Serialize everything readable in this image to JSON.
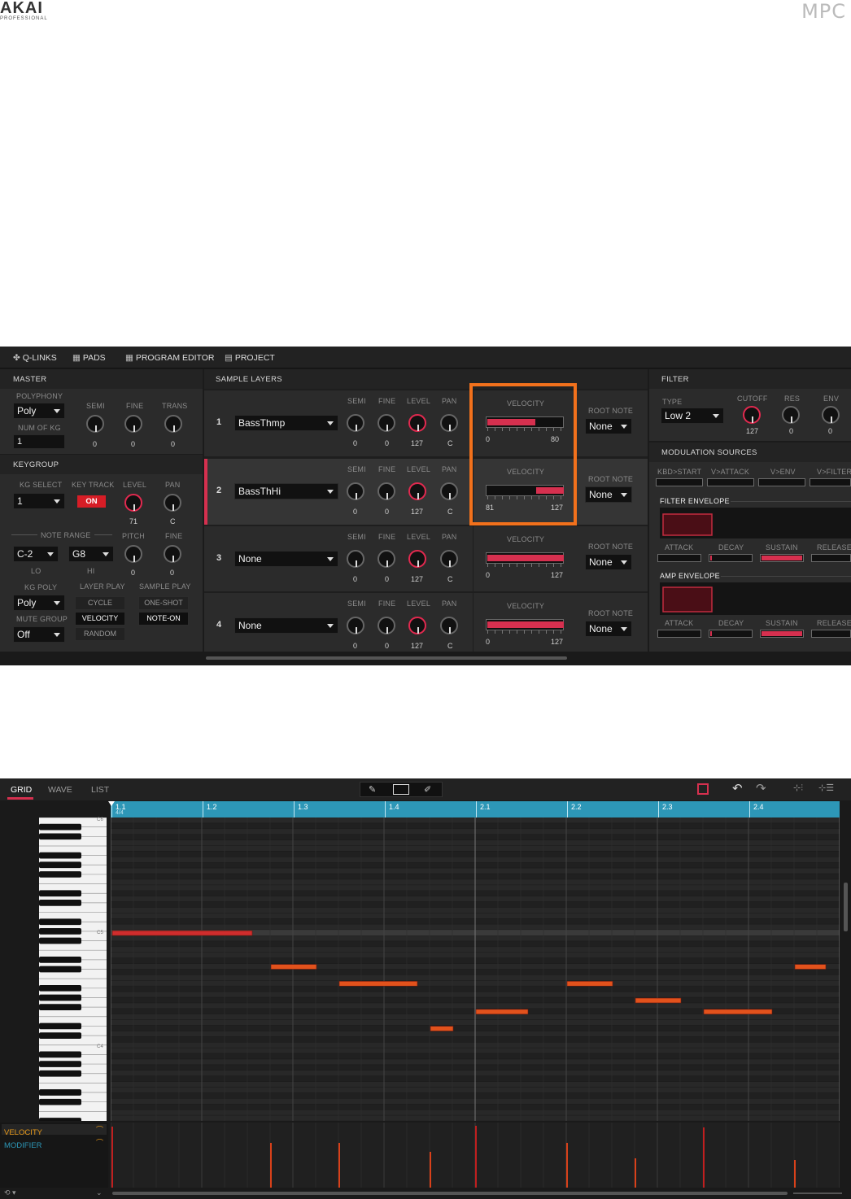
{
  "brand": {
    "left": "AKAI",
    "left_sub": "PROFESSIONAL",
    "right": "MPC"
  },
  "editor": {
    "tabs": [
      "Q-LINKS",
      "PADS",
      "PROGRAM EDITOR",
      "PROJECT"
    ],
    "master": {
      "title": "MASTER",
      "polyphony_label": "POLYPHONY",
      "polyphony_value": "Poly",
      "num_kg_label": "NUM OF KG",
      "num_kg_value": "1",
      "semi_label": "SEMI",
      "fine_label": "FINE",
      "trans_label": "TRANS",
      "semi": "0",
      "fine": "0",
      "trans": "0"
    },
    "keygroup": {
      "title": "KEYGROUP",
      "kg_select_label": "KG SELECT",
      "kg_select_value": "1",
      "key_track_label": "KEY TRACK",
      "key_track_value": "ON",
      "level_label": "LEVEL",
      "level_value": "71",
      "pan_label": "PAN",
      "pan_value": "C",
      "note_range_label": "NOTE RANGE",
      "lo_value": "C-2",
      "hi_value": "G8",
      "lo_label": "LO",
      "hi_label": "HI",
      "pitch_label": "PITCH",
      "pitch_value": "0",
      "fine_label": "FINE",
      "fine_value": "0",
      "kg_poly_label": "KG POLY",
      "kg_poly_value": "Poly",
      "mute_group_label": "MUTE GROUP",
      "mute_group_value": "Off",
      "layer_play_label": "LAYER PLAY",
      "layer_play_options": [
        "CYCLE",
        "VELOCITY",
        "RANDOM"
      ],
      "sample_play_label": "SAMPLE PLAY",
      "sample_play_options": [
        "ONE-SHOT",
        "NOTE-ON"
      ]
    },
    "sample_layers": {
      "title": "SAMPLE LAYERS",
      "semi_label": "SEMI",
      "fine_label": "FINE",
      "level_label": "LEVEL",
      "pan_label": "PAN",
      "velocity_label": "VELOCITY",
      "root_note_label": "ROOT NOTE",
      "layers": [
        {
          "num": "1",
          "sample": "BassThmp",
          "semi": "0",
          "fine": "0",
          "level": "127",
          "pan": "C",
          "vel_lo": "0",
          "vel_hi": "80",
          "root": "None"
        },
        {
          "num": "2",
          "sample": "BassThHi",
          "semi": "0",
          "fine": "0",
          "level": "127",
          "pan": "C",
          "vel_lo": "81",
          "vel_hi": "127",
          "root": "None"
        },
        {
          "num": "3",
          "sample": "None",
          "semi": "0",
          "fine": "0",
          "level": "127",
          "pan": "C",
          "vel_lo": "0",
          "vel_hi": "127",
          "root": "None"
        },
        {
          "num": "4",
          "sample": "None",
          "semi": "0",
          "fine": "0",
          "level": "127",
          "pan": "C",
          "vel_lo": "0",
          "vel_hi": "127",
          "root": "None"
        }
      ]
    },
    "filter": {
      "title": "FILTER",
      "type_label": "TYPE",
      "type_value": "Low 2",
      "cutoff_label": "CUTOFF",
      "cutoff_value": "127",
      "res_label": "RES",
      "res_value": "0",
      "env_label": "ENV",
      "env_value": "0"
    },
    "mod": {
      "title": "MODULATION SOURCES",
      "sources": [
        "KBD>START",
        "V>ATTACK",
        "V>ENV",
        "V>FILTER"
      ],
      "filter_env_title": "FILTER ENVELOPE",
      "amp_env_title": "AMP ENVELOPE",
      "env_labels": [
        "ATTACK",
        "DECAY",
        "SUSTAIN",
        "RELEASE"
      ]
    }
  },
  "grid": {
    "tabs": [
      "GRID",
      "WAVE",
      "LIST"
    ],
    "ruler": [
      "1.1",
      "1.2",
      "1.3",
      "1.4",
      "2.1",
      "2.2",
      "2.3",
      "2.4"
    ],
    "time_sig": "4/4",
    "octave_labels": [
      "C6",
      "C5",
      "C4"
    ],
    "lanes": [
      "VELOCITY",
      "MODIFIER"
    ]
  }
}
